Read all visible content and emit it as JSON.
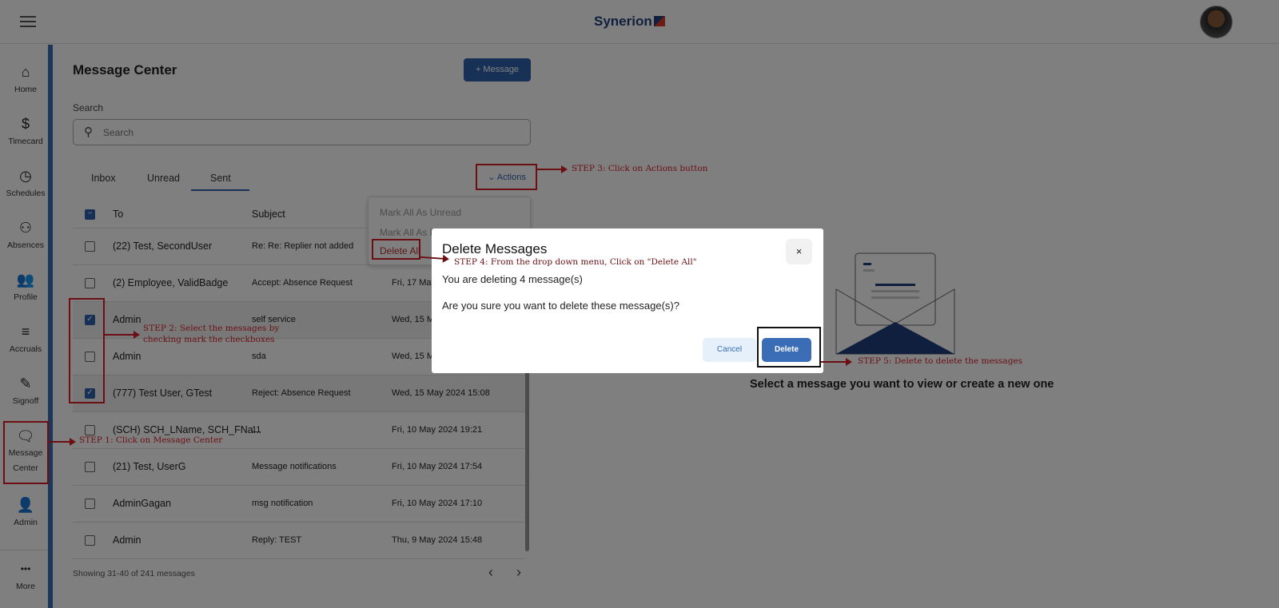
{
  "header": {
    "logo": "Synerion"
  },
  "sidebar": {
    "items": [
      {
        "label": "Home",
        "icon": "⌂"
      },
      {
        "label": "Timecard",
        "icon": "$"
      },
      {
        "label": "Schedules",
        "icon": "◷"
      },
      {
        "label": "Absences",
        "icon": "⚇"
      },
      {
        "label": "Profile",
        "icon": "👥"
      },
      {
        "label": "Accruals",
        "icon": "≡"
      },
      {
        "label": "Signoff",
        "icon": "✎"
      },
      {
        "label": "Message Center",
        "icon": "🗨"
      },
      {
        "label": "Admin",
        "icon": "👤"
      },
      {
        "label": "More",
        "icon": "•••"
      }
    ]
  },
  "main": {
    "title": "Message Center",
    "new_message": "+  Message",
    "search_label": "Search",
    "search_placeholder": "Search",
    "tabs": [
      "Inbox",
      "Unread",
      "Sent"
    ],
    "actions": "⌄  Actions",
    "columns": {
      "to": "To",
      "subject": "Subject"
    },
    "rows": [
      {
        "to": "(22) Test, SecondUser",
        "subject": "Re: Re: Replier not added",
        "date": "",
        "checked": false
      },
      {
        "to": "(2) Employee, ValidBadge",
        "subject": "Accept: Absence Request",
        "date": "Fri, 17 May",
        "checked": false
      },
      {
        "to": "Admin",
        "subject": "self service",
        "date": "Wed, 15 Ma",
        "checked": true
      },
      {
        "to": "Admin",
        "subject": "sda",
        "date": "Wed, 15 Ma",
        "checked": false
      },
      {
        "to": "(777) Test User, GTest",
        "subject": "Reject: Absence Request",
        "date": "Wed, 15 May 2024 15:08",
        "checked": true
      },
      {
        "to": "(SCH) SCH_LName, SCH_FNa...",
        "subject": "11",
        "date": "Fri, 10 May 2024 19:21",
        "checked": false
      },
      {
        "to": "(21) Test, UserG",
        "subject": "Message notifications",
        "date": "Fri, 10 May 2024 17:54",
        "checked": false
      },
      {
        "to": "AdminGagan",
        "subject": "msg notification",
        "date": "Fri, 10 May 2024 17:10",
        "checked": false
      },
      {
        "to": "Admin",
        "subject": "Reply: TEST",
        "date": "Thu, 9 May 2024 15:48",
        "checked": false
      }
    ],
    "footer": "Showing 31-40 of 241 messages",
    "dropdown": [
      "Mark All As Unread",
      "Mark All As R",
      "Delete All"
    ],
    "empty_text": "Select a message you want to view or create a new one"
  },
  "dialog": {
    "title": "Delete Messages",
    "line1": "You are deleting 4 message(s)",
    "line2": "Are you sure you want to delete these message(s)?",
    "cancel": "Cancel",
    "delete": "Delete",
    "close": "×"
  },
  "annotations": {
    "step1": "STEP 1: Click on Message Center",
    "step2a": "STEP 2: Select the messages by",
    "step2b": "checking mark the checkboxes",
    "step3": "STEP 3: Click on Actions button",
    "step4": "STEP 4: From the drop down menu, Click on \"Delete All\"",
    "step5": "STEP 5: Delete to delete the messages"
  },
  "colors": {
    "accent": "#2f63ad",
    "annotation": "#6b0f14"
  }
}
